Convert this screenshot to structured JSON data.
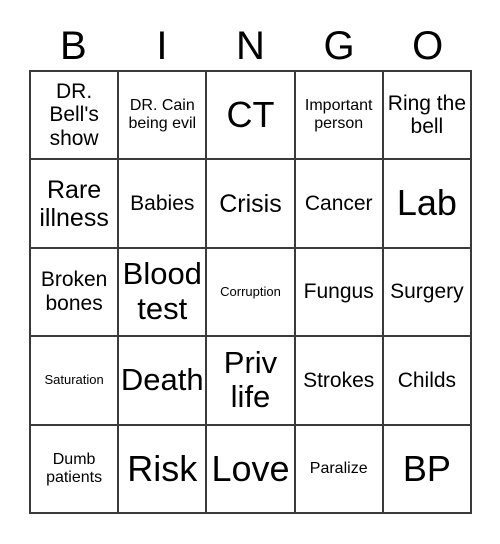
{
  "card": {
    "header": {
      "letters": [
        "B",
        "I",
        "N",
        "G",
        "O"
      ]
    },
    "colors": {
      "border": "#3a3a3a",
      "text": "#000000",
      "background": "#ffffff"
    },
    "rows": [
      [
        {
          "text": "DR. Bell's show",
          "size": "md"
        },
        {
          "text": "DR. Cain being evil",
          "size": "sm"
        },
        {
          "text": "CT",
          "size": "xxl"
        },
        {
          "text": "Important person",
          "size": "sm"
        },
        {
          "text": "Ring the bell",
          "size": "md"
        }
      ],
      [
        {
          "text": "Rare illness",
          "size": "lg"
        },
        {
          "text": "Babies",
          "size": "md"
        },
        {
          "text": "Crisis",
          "size": "lg"
        },
        {
          "text": "Cancer",
          "size": "md"
        },
        {
          "text": "Lab",
          "size": "xxl"
        }
      ],
      [
        {
          "text": "Broken bones",
          "size": "md"
        },
        {
          "text": "Blood test",
          "size": "xl"
        },
        {
          "text": "Corruption",
          "size": "xs"
        },
        {
          "text": "Fungus",
          "size": "md"
        },
        {
          "text": "Surgery",
          "size": "md"
        }
      ],
      [
        {
          "text": "Saturation",
          "size": "xs"
        },
        {
          "text": "Death",
          "size": "xl"
        },
        {
          "text": "Priv life",
          "size": "xl"
        },
        {
          "text": "Strokes",
          "size": "md"
        },
        {
          "text": "Childs",
          "size": "md"
        }
      ],
      [
        {
          "text": "Dumb patients",
          "size": "sm"
        },
        {
          "text": "Risk",
          "size": "xxl"
        },
        {
          "text": "Love",
          "size": "xxl"
        },
        {
          "text": "Paralize",
          "size": "sm"
        },
        {
          "text": "BP",
          "size": "xxl"
        }
      ]
    ]
  }
}
